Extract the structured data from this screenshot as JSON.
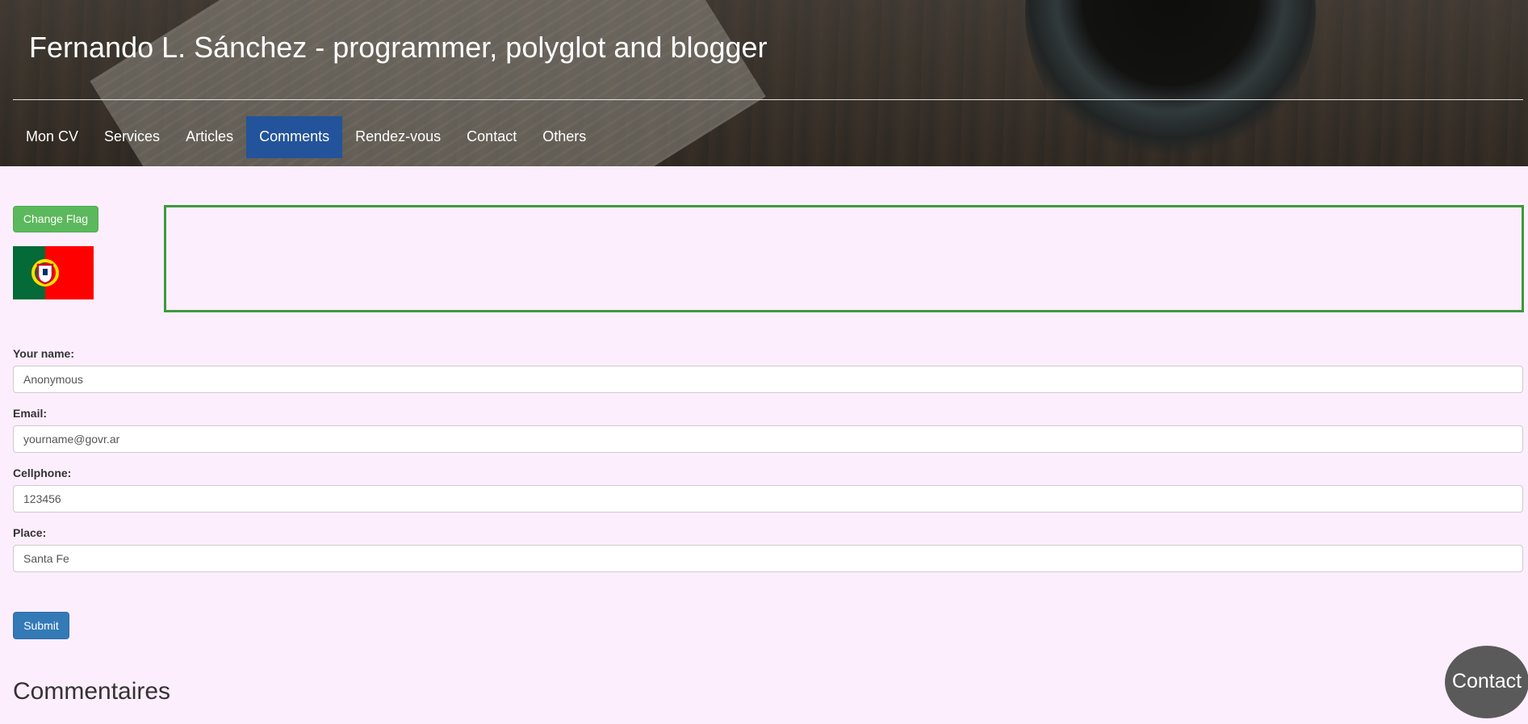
{
  "header": {
    "title": "Fernando L. Sánchez - programmer, polyglot and blogger"
  },
  "nav": {
    "items": [
      "Mon CV",
      "Services",
      "Articles",
      "Comments",
      "Rendez-vous",
      "Contact",
      "Others"
    ],
    "active": "Comments"
  },
  "flag_panel": {
    "button_label": "Change Flag",
    "flag_icon": "portugal-flag-icon",
    "colors": {
      "green": "#046a38",
      "red": "#ff0000",
      "accent_border": "#3c9a3c"
    }
  },
  "form": {
    "name_label": "Your name:",
    "name_value": "Anonymous",
    "email_label": "Email:",
    "email_value": "yourname@govr.ar",
    "cellphone_label": "Cellphone:",
    "cellphone_value": "123456",
    "place_label": "Place:",
    "place_value": "Santa Fe",
    "submit_label": "Submit"
  },
  "comments": {
    "heading": "Commentaires"
  },
  "contact_fab": {
    "label": "Contact"
  },
  "colors": {
    "page_background": "#fdeefd",
    "nav_active": "#23539a",
    "success_button": "#5cb85c",
    "primary_button": "#337ab7",
    "fab": "#5a5a5a"
  }
}
